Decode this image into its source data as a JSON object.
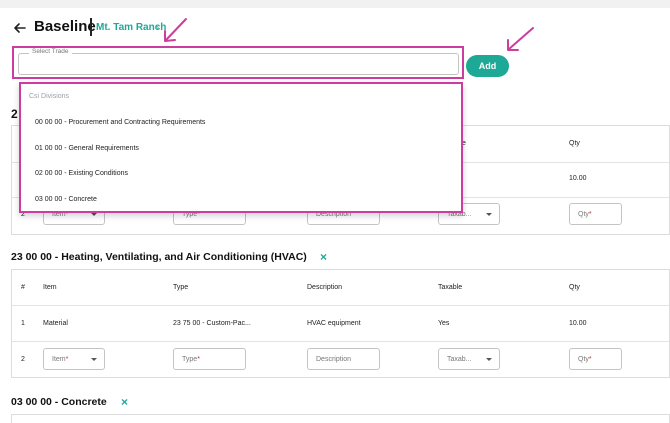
{
  "header": {
    "title": "Baseline",
    "breadcrumb": "Mt. Tam Ranch",
    "breadcrumb_chevron": "›"
  },
  "trade_select": {
    "label": "Select Trade",
    "add_label": "Add"
  },
  "dropdown": {
    "heading": "Csi Divisions",
    "options": [
      "00 00 00 - Procurement and Contracting Requirements",
      "01 00 00 - General Requirements",
      "02 00 00 - Existing Conditions",
      "03 00 00 - Concrete"
    ]
  },
  "section_peek": {
    "number_fragment": "2",
    "header_fragment": "e",
    "qty_header": "Qty",
    "row1_qty": "10.00",
    "row2_num": "2",
    "item_placeholder": "Item",
    "type_placeholder": "Type",
    "desc_placeholder": "Description",
    "taxable_placeholder": "Taxab...",
    "qty_placeholder": "Qty"
  },
  "sections": [
    {
      "title": "23 00 00 - Heating, Ventilating, and Air Conditioning (HVAC)",
      "remove_icon": "×",
      "columns": [
        "#",
        "Item",
        "Type",
        "Description",
        "Taxable",
        "Qty"
      ],
      "rows": [
        {
          "num": "1",
          "item": "Material",
          "type": "23 75 00 - Custom-Pac...",
          "description": "HVAC equipment",
          "taxable": "Yes",
          "qty": "10.00"
        }
      ],
      "new_row": {
        "num": "2",
        "item_placeholder": "Item",
        "type_placeholder": "Type",
        "desc_placeholder": "Description",
        "taxable_placeholder": "Taxab...",
        "qty_placeholder": "Qty"
      }
    },
    {
      "title": "03 00 00 - Concrete",
      "remove_icon": "×"
    }
  ],
  "required_mark": "*",
  "colors": {
    "accent": "#1ea896",
    "annotation": "#cc3d9d",
    "required": "#c0392b"
  },
  "icons": {
    "back": "arrow-left-icon",
    "annotation_arrow": "annotation-arrow-icon",
    "remove": "close-icon",
    "caret": "caret-down-icon"
  }
}
